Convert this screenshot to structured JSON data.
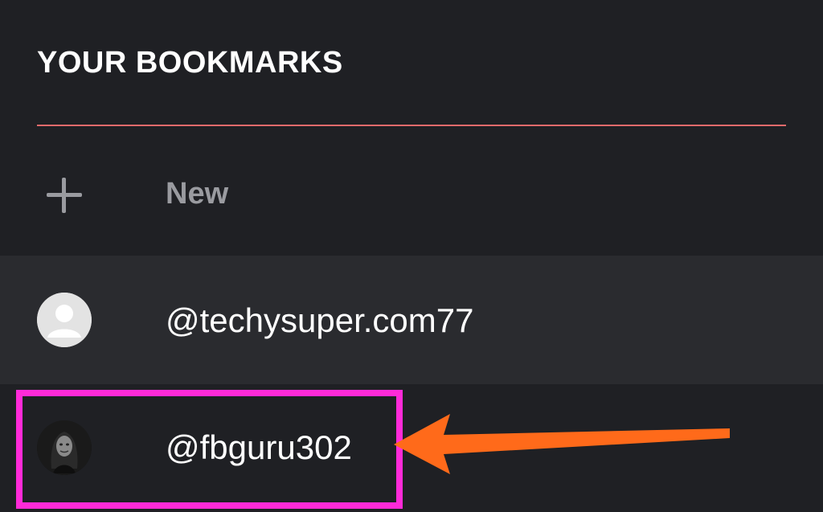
{
  "header": {
    "title": "YOUR BOOKMARKS"
  },
  "colors": {
    "background": "#1f2024",
    "row_alt_background": "#2a2b2f",
    "divider": "#e56b6b",
    "highlight_box": "#ff2ad8",
    "arrow": "#ff6a1a",
    "muted_text": "#9a9ba0"
  },
  "new_row": {
    "icon": "plus-icon",
    "label": "New"
  },
  "bookmarks": [
    {
      "icon": "default-avatar-icon",
      "username": "@techysuper.com77"
    },
    {
      "icon": "profile-photo-avatar",
      "username": "@fbguru302"
    }
  ],
  "annotations": {
    "highlight": "magenta-box",
    "pointer": "orange-arrow"
  }
}
